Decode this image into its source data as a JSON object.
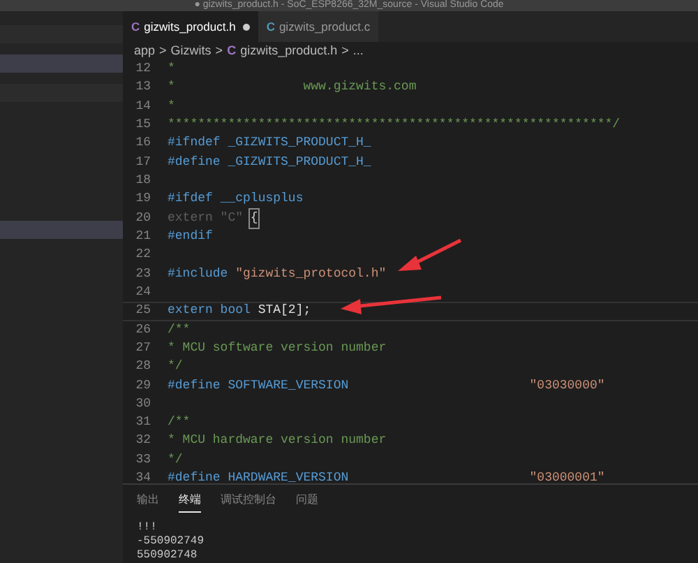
{
  "window": {
    "title": "● gizwits_product.h - SoC_ESP8266_32M_source - Visual Studio Code"
  },
  "sidebar": {
    "items": [
      {
        "selected": false
      },
      {
        "selected": true
      },
      {
        "selected": false
      },
      {
        "selected": true
      }
    ]
  },
  "tabs": [
    {
      "icon": "C",
      "label": "gizwits_product.h",
      "selected": true,
      "modified": true
    },
    {
      "icon": "C",
      "label": "gizwits_product.c",
      "selected": false
    }
  ],
  "breadcrumb": {
    "items": [
      "app",
      "Gizwits",
      "gizwits_product.h",
      "..."
    ],
    "separator": ">",
    "file_icon": "C"
  },
  "editor": {
    "lines": [
      {
        "number": "12",
        "tokens": [
          {
            "kind": "comment",
            "text": "*"
          }
        ]
      },
      {
        "number": "13",
        "tokens": [
          {
            "kind": "comment",
            "text": "*                 www.gizwits.com"
          }
        ]
      },
      {
        "number": "14",
        "tokens": [
          {
            "kind": "comment",
            "text": "*"
          }
        ]
      },
      {
        "number": "15",
        "tokens": [
          {
            "kind": "comment",
            "text": "***********************************************************/"
          }
        ]
      },
      {
        "number": "16",
        "tokens": [
          {
            "kind": "directive",
            "text": "#ifndef "
          },
          {
            "kind": "macro",
            "text": "_GIZWITS_PRODUCT_H_"
          }
        ]
      },
      {
        "number": "17",
        "tokens": [
          {
            "kind": "directive",
            "text": "#define "
          },
          {
            "kind": "macro",
            "text": "_GIZWITS_PRODUCT_H_"
          }
        ]
      },
      {
        "number": "18"
      },
      {
        "number": "19",
        "tokens": [
          {
            "kind": "directive",
            "text": "#ifdef "
          },
          {
            "kind": "macro",
            "text": "__cplusplus"
          }
        ]
      },
      {
        "number": "20",
        "tokens": [
          {
            "kind": "inactive",
            "text": "extern \"C\" "
          },
          {
            "kind": "bracket",
            "text": "{"
          }
        ]
      },
      {
        "number": "21",
        "tokens": [
          {
            "kind": "directive",
            "text": "#endif"
          }
        ]
      },
      {
        "number": "22"
      },
      {
        "number": "23",
        "tokens": [
          {
            "kind": "directive",
            "text": "#include "
          },
          {
            "kind": "string",
            "text": "\"gizwits_protocol.h\""
          }
        ]
      },
      {
        "number": "24"
      },
      {
        "number": "25",
        "tokens": [
          {
            "kind": "keyword",
            "text": "extern bool "
          },
          {
            "kind": "plain",
            "text": "STA[2];"
          }
        ],
        "current": true
      },
      {
        "number": "26",
        "tokens": [
          {
            "kind": "comment",
            "text": "/**"
          }
        ]
      },
      {
        "number": "27",
        "tokens": [
          {
            "kind": "comment",
            "text": "* MCU software version number"
          }
        ]
      },
      {
        "number": "28",
        "tokens": [
          {
            "kind": "comment",
            "text": "*/"
          }
        ]
      },
      {
        "number": "29",
        "tokens": [
          {
            "kind": "directive",
            "text": "#define "
          },
          {
            "kind": "macro",
            "text": "SOFTWARE_VERSION                        "
          },
          {
            "kind": "string",
            "text": "\"03030000\""
          }
        ]
      },
      {
        "number": "30"
      },
      {
        "number": "31",
        "tokens": [
          {
            "kind": "comment",
            "text": "/**"
          }
        ]
      },
      {
        "number": "32",
        "tokens": [
          {
            "kind": "comment",
            "text": "* MCU hardware version number"
          }
        ]
      },
      {
        "number": "33",
        "tokens": [
          {
            "kind": "comment",
            "text": "*/"
          }
        ]
      },
      {
        "number": "34",
        "tokens": [
          {
            "kind": "directive",
            "text": "#define "
          },
          {
            "kind": "macro",
            "text": "HARDWARE_VERSION                        "
          },
          {
            "kind": "string",
            "text": "\"03000001\""
          }
        ]
      }
    ]
  },
  "panel": {
    "tabs": [
      {
        "label": "输出",
        "selected": false
      },
      {
        "label": "终端",
        "selected": true
      },
      {
        "label": "调试控制台",
        "selected": false
      },
      {
        "label": "问题",
        "selected": false
      }
    ],
    "terminal_lines": [
      "!!!",
      "-550902749",
      "550902748"
    ]
  }
}
